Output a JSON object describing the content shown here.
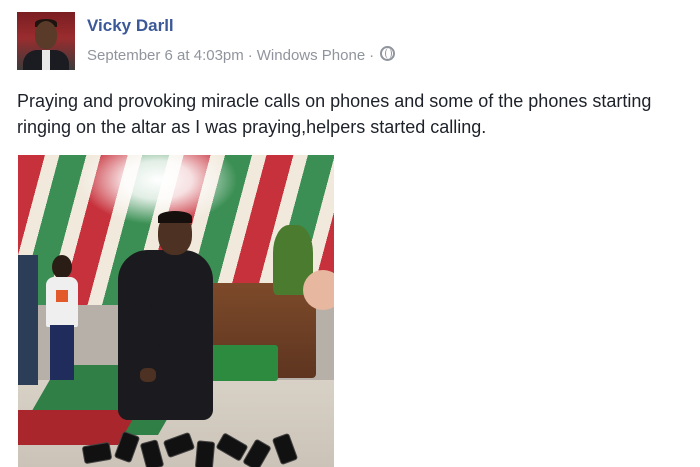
{
  "post": {
    "author": "Vicky Darll",
    "timestamp": "September 6 at 4:03pm",
    "source": "Windows Phone",
    "separator": "·",
    "privacy_icon": "globe-icon",
    "text": "Praying and provoking miracle calls on phones and some of the phones starting ringing on the altar as I was praying,helpers started calling."
  },
  "colors": {
    "author_link": "#3b5998",
    "meta_text": "#90949c",
    "body_text": "#1d2129"
  }
}
